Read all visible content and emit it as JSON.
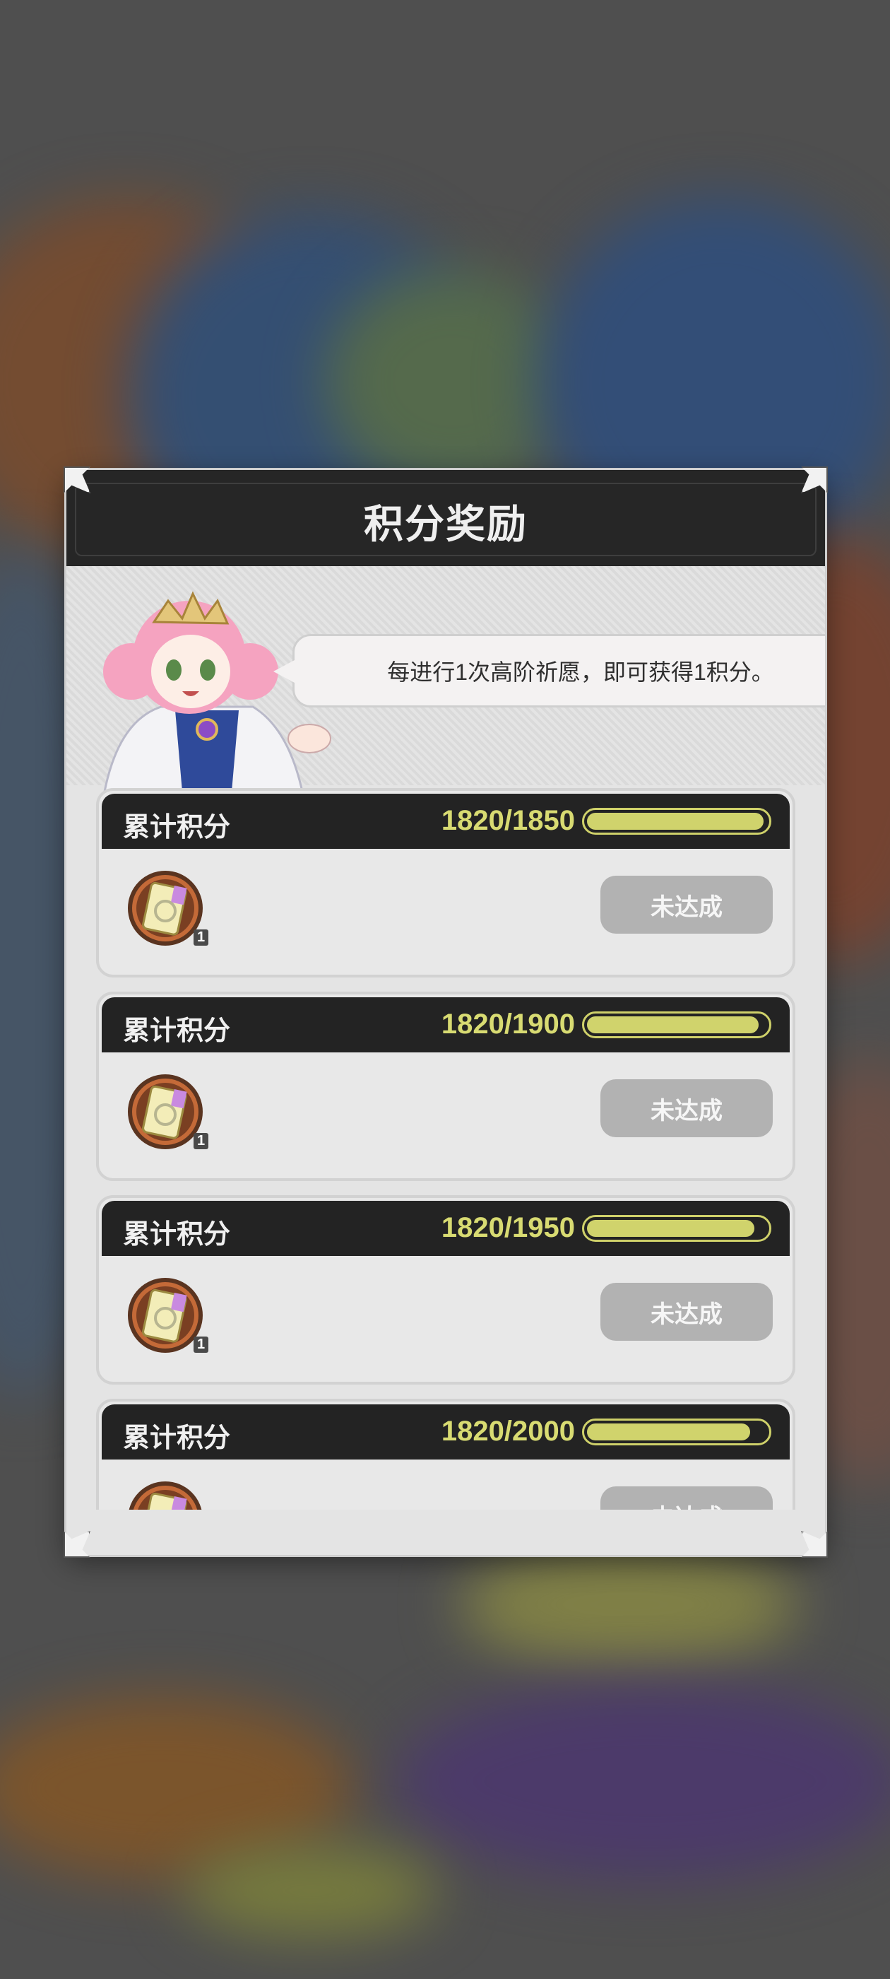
{
  "modal": {
    "title": "积分奖励",
    "hint": "每进行1次高阶祈愿，即可获得1积分。"
  },
  "rewards": [
    {
      "label": "累计积分",
      "score": "1820/1850",
      "progress": 0.984,
      "item_count": "1",
      "status": "未达成"
    },
    {
      "label": "累计积分",
      "score": "1820/1900",
      "progress": 0.958,
      "item_count": "1",
      "status": "未达成"
    },
    {
      "label": "累计积分",
      "score": "1820/1950",
      "progress": 0.933,
      "item_count": "1",
      "status": "未达成"
    },
    {
      "label": "累计积分",
      "score": "1820/2000",
      "progress": 0.91,
      "item_count": "1",
      "status": "未达成"
    }
  ],
  "colors": {
    "accent": "#d0d36c",
    "header": "#262626",
    "button_disabled": "#b2b2b2"
  },
  "icons": {
    "reward_item": "wish-ticket-icon",
    "character": "guide-character-portrait"
  }
}
